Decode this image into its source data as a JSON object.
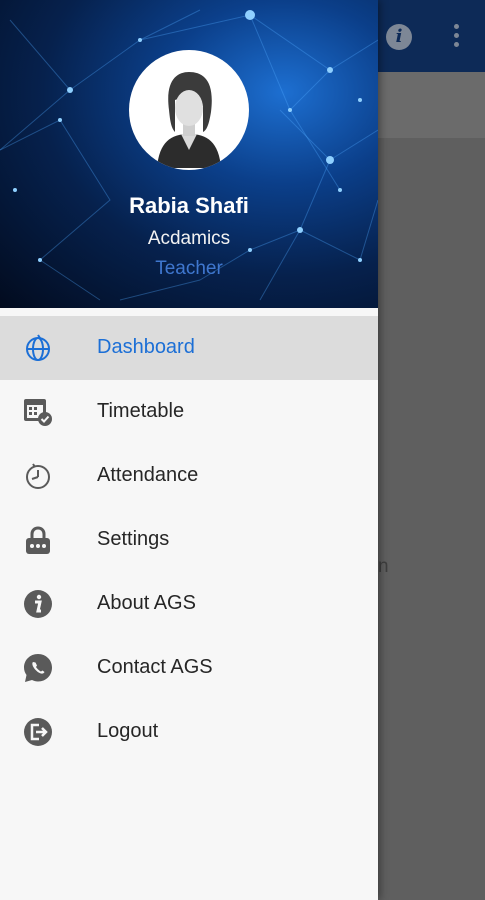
{
  "app": {
    "partial_text": "n"
  },
  "profile": {
    "name": "Rabia Shafi",
    "department": "Acdamics",
    "role": "Teacher"
  },
  "menu": {
    "items": [
      {
        "label": "Dashboard",
        "icon": "globe-icon",
        "active": true
      },
      {
        "label": "Timetable",
        "icon": "calendar-check-icon",
        "active": false
      },
      {
        "label": "Attendance",
        "icon": "clock-icon",
        "active": false
      },
      {
        "label": "Settings",
        "icon": "lock-icon",
        "active": false
      },
      {
        "label": "About AGS",
        "icon": "info-icon",
        "active": false
      },
      {
        "label": "Contact AGS",
        "icon": "whatsapp-icon",
        "active": false
      },
      {
        "label": "Logout",
        "icon": "logout-icon",
        "active": false
      }
    ]
  },
  "colors": {
    "accent": "#1c6fd6",
    "app_bar": "#0d2a57",
    "active_bg": "#dcdcdc",
    "icon_gray": "#5a5a5a"
  }
}
